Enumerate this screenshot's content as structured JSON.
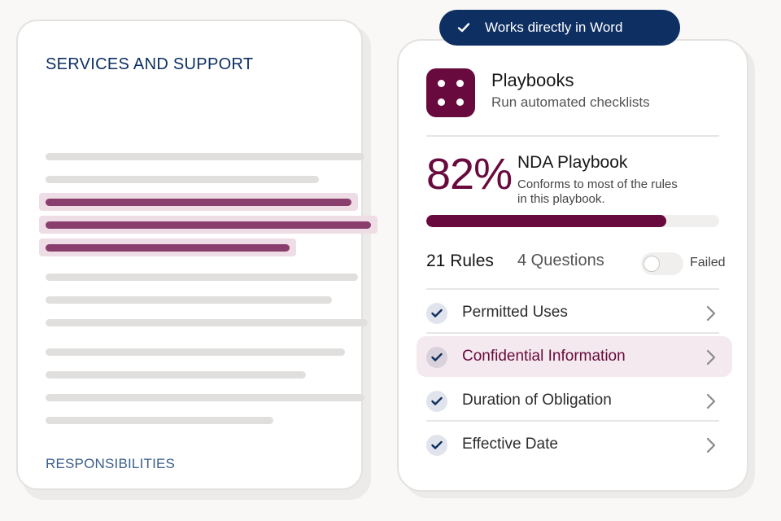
{
  "document": {
    "heading": "SERVICES AND SUPPORT",
    "footer_heading": "RESPONSIBILITIES"
  },
  "badge": {
    "label": "Works directly in Word",
    "icon": "check-icon"
  },
  "app": {
    "title": "Playbooks",
    "subtitle": "Run automated checklists",
    "icon": "dice-four-icon",
    "color": "#690a3e"
  },
  "playbook": {
    "score": "82%",
    "progress_percent": 82,
    "name": "NDA Playbook",
    "description": "Conforms to most of the rules in this playbook."
  },
  "tabs": {
    "rules": "21 Rules",
    "questions": "4 Questions",
    "failed_toggle_label": "Failed",
    "failed_toggle_on": false
  },
  "rules": [
    {
      "label": "Permitted Uses",
      "status": "passed",
      "active": false
    },
    {
      "label": "Confidential Information",
      "status": "passed",
      "active": true
    },
    {
      "label": "Duration of Obligation",
      "status": "passed",
      "active": false
    },
    {
      "label": "Effective Date",
      "status": "passed",
      "active": false
    }
  ],
  "colors": {
    "navy": "#0d2f62",
    "plum": "#690a3e",
    "highlight": "#8a3e6d"
  }
}
